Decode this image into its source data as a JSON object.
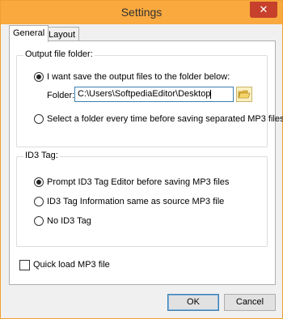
{
  "window": {
    "title": "Settings",
    "close_glyph": "✕"
  },
  "tabs": [
    {
      "label": "General",
      "active": true
    },
    {
      "label": "Layout",
      "active": false
    }
  ],
  "output_group": {
    "title": "Output file folder:",
    "option_save_to_folder": "I want save the output files to the folder below:",
    "folder_label": "Folder:",
    "folder_value": "C:\\Users\\SoftpediaEditor\\Desktop",
    "option_select_each_time": "Select a folder every time before saving separated MP3 files",
    "selected": "save_to_folder"
  },
  "id3_group": {
    "title": "ID3 Tag:",
    "options": [
      {
        "label": "Prompt ID3 Tag Editor before saving MP3 files",
        "checked": true
      },
      {
        "label": "ID3 Tag Information same as source MP3 file",
        "checked": false
      },
      {
        "label": "No ID3 Tag",
        "checked": false
      }
    ]
  },
  "quick_load": {
    "label": "Quick load MP3 file",
    "checked": false
  },
  "buttons": {
    "ok": "OK",
    "cancel": "Cancel"
  },
  "icons": {
    "folder": "folder-open-icon",
    "close": "close-icon"
  },
  "colors": {
    "titlebar": "#f9a93e",
    "close_button": "#c7402b",
    "focus_border": "#3c7fb1"
  }
}
